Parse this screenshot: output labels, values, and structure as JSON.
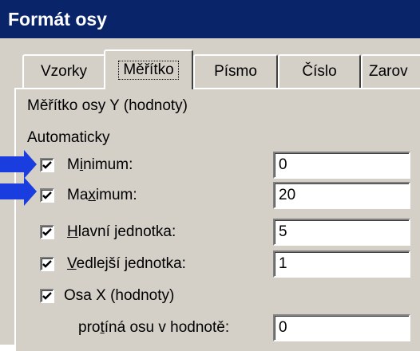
{
  "window": {
    "title": "Formát osy"
  },
  "tabs": [
    {
      "label": "Vzorky",
      "active": false
    },
    {
      "label": "Měřítko",
      "active": true
    },
    {
      "label": "Písmo",
      "active": false
    },
    {
      "label": "Číslo",
      "active": false
    },
    {
      "label": "Zarov",
      "active": false
    }
  ],
  "scale": {
    "section_title": "Měřítko osy Y (hodnoty)",
    "auto_label": "Automaticky",
    "minimum": {
      "label_pre": "M",
      "label_ul": "i",
      "label_post": "nimum:",
      "checked": true,
      "value": "0"
    },
    "maximum": {
      "label_pre": "Ma",
      "label_ul": "x",
      "label_post": "imum:",
      "checked": true,
      "value": "20"
    },
    "major_unit": {
      "label_pre": "",
      "label_ul": "H",
      "label_post": "lavní jednotka:",
      "checked": true,
      "value": "5"
    },
    "minor_unit": {
      "label_pre": "",
      "label_ul": "V",
      "label_post": "edlejší jednotka:",
      "checked": true,
      "value": "1"
    },
    "x_axis": {
      "label": "Osa X (hodnoty)",
      "checked": true
    },
    "crosses_at": {
      "label_pre": "pro",
      "label_ul": "t",
      "label_post": "íná osu v hodnotě:",
      "value": "0"
    }
  },
  "colors": {
    "title_bar": "#0a246a",
    "dialog_face": "#d4d0c8",
    "annotation_arrow": "#1a3de0"
  }
}
